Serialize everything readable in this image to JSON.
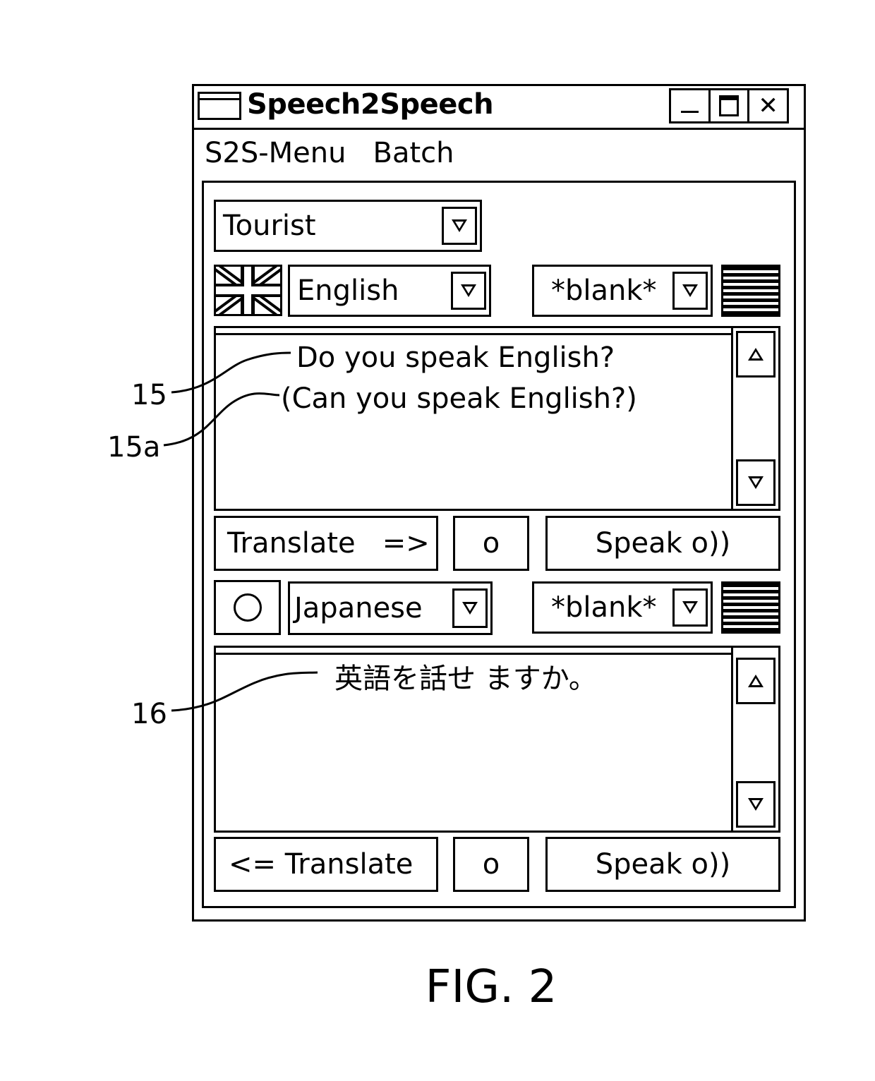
{
  "window": {
    "title": "Speech2Speech",
    "controls": {
      "minimize": "minimize-button",
      "maximize": "maximize-button",
      "close_glyph": "✕"
    }
  },
  "menubar": {
    "items": [
      "S2S-Menu",
      "Batch"
    ]
  },
  "profile_dropdown": {
    "value": "Tourist"
  },
  "source": {
    "flag": "uk-flag-icon",
    "language": "English",
    "secondary": "*blank*",
    "secondary_flag": "striped-flag-icon",
    "text_lines": [
      "Do you speak English?",
      "(Can you speak English?)"
    ],
    "translate_button": "Translate   =>",
    "record_button": "o",
    "speak_button": "Speak o))"
  },
  "target": {
    "flag": "circle-flag-icon",
    "language": "Japanese",
    "secondary": "*blank*",
    "secondary_flag": "striped-flag-icon",
    "text_lines": [
      "英語を話せ ますか。"
    ],
    "translate_button": "<= Translate",
    "record_button": "o",
    "speak_button": "Speak o))"
  },
  "callouts": [
    "15",
    "15a",
    "16"
  ],
  "figure_label": "FIG. 2"
}
